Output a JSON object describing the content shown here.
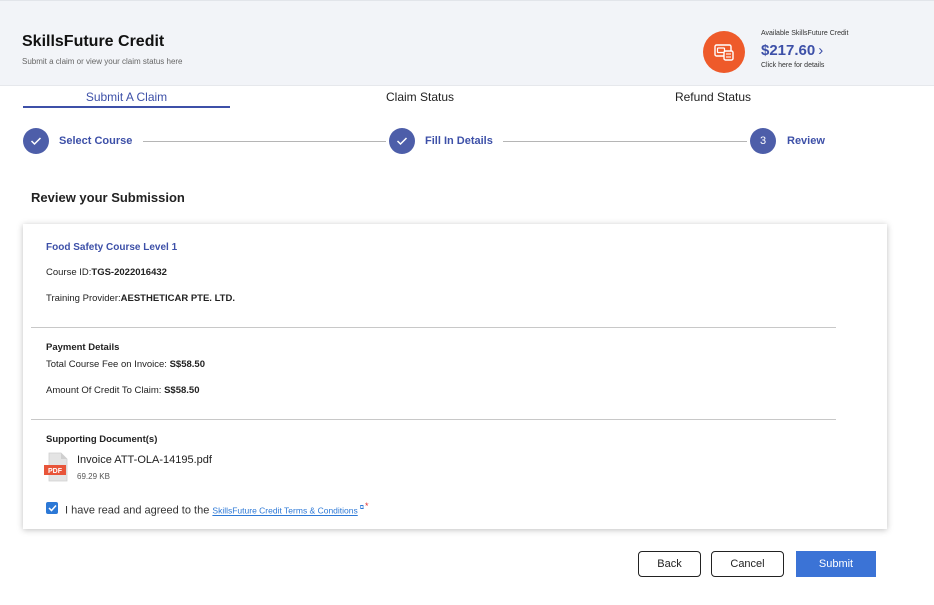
{
  "header": {
    "title": "SkillsFuture Credit",
    "subtitle": "Submit a claim or view your claim status here",
    "credit_label": "Available SkillsFuture Credit",
    "credit_amount": "$217.60",
    "credit_details": "Click here for details",
    "credit_icon": "credit-wallet-icon",
    "accent_color": "#ee5a2a"
  },
  "tabs": [
    {
      "label": "Submit A Claim",
      "active": true
    },
    {
      "label": "Claim Status",
      "active": false
    },
    {
      "label": "Refund Status",
      "active": false
    }
  ],
  "steps": [
    {
      "label": "Select Course",
      "state": "done"
    },
    {
      "label": "Fill In Details",
      "state": "done"
    },
    {
      "number": "3",
      "label": "Review",
      "state": "current"
    }
  ],
  "review": {
    "title": "Review your Submission",
    "course_name": "Food Safety Course Level 1",
    "course_id_label": "Course ID:",
    "course_id": "TGS-2022016432",
    "provider_label": "Training Provider:",
    "provider": "AESTHETICAR PTE. LTD.",
    "payment_heading": "Payment Details",
    "fee_label": "Total Course Fee on Invoice:",
    "fee_value": "S$58.50",
    "claim_label": "Amount Of Credit To Claim:",
    "claim_value": "S$58.50",
    "docs_heading": "Supporting Document(s)",
    "file_name": "Invoice ATT-OLA-14195.pdf",
    "file_size": "69.29 KB",
    "file_icon_label": "PDF",
    "agree_text": "I have read and agreed to the",
    "terms_link": "SkillsFuture Credit Terms & Conditions",
    "agree_checked": true
  },
  "buttons": {
    "back": "Back",
    "cancel": "Cancel",
    "submit": "Submit"
  },
  "colors": {
    "primary": "#3d50a8",
    "submit": "#3b73d6",
    "checkbox": "#2c78d6"
  }
}
